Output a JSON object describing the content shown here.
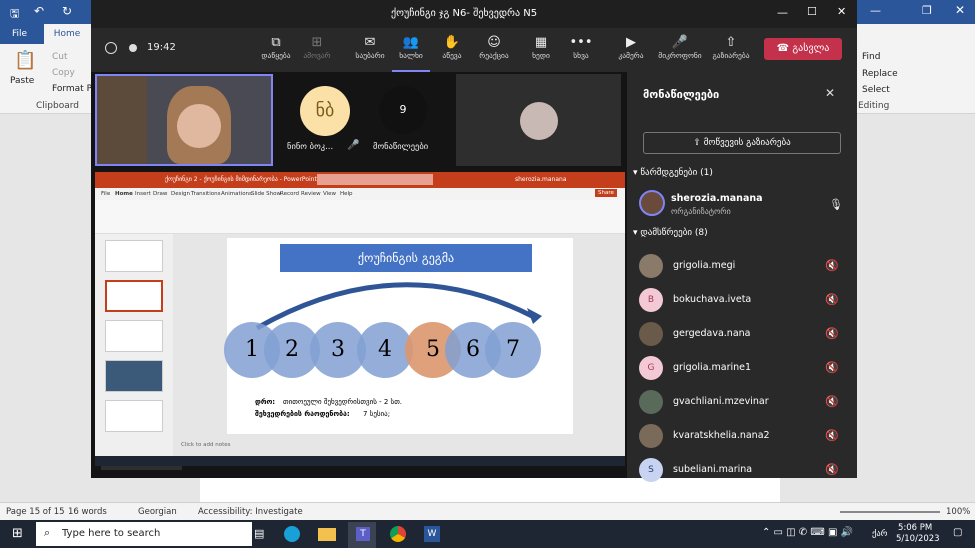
{
  "word": {
    "tabs": [
      "File",
      "Home"
    ],
    "clipboard": {
      "paste": "Paste",
      "cut": "Cut",
      "copy": "Copy",
      "format_painter": "Format Pai",
      "group": "Clipboard"
    },
    "editing": {
      "find": "Find",
      "replace": "Replace",
      "select": "Select",
      "group": "Editing"
    },
    "status": {
      "page": "Page 15 of 15",
      "words": "16 words",
      "language": "Georgian",
      "accessibility": "Accessibility: Investigate",
      "zoom": "100%"
    }
  },
  "teams": {
    "title": "ქოუჩინგი ჯგ N6- შეხვედრა N5",
    "timer": "19:42",
    "toolbar": [
      {
        "icon": "⧉",
        "label": "დაწყება"
      },
      {
        "icon": "⊞",
        "label": "ამოვარ"
      },
      {
        "icon": "✉",
        "label": "საუბარი"
      },
      {
        "icon": "👥",
        "label": "ხალხი"
      },
      {
        "icon": "✋",
        "label": "აწევა"
      },
      {
        "icon": "☺",
        "label": "რეაქცია"
      },
      {
        "icon": "▦",
        "label": "ხედი"
      },
      {
        "icon": "•••",
        "label": "სხვა"
      },
      {
        "icon": "▶",
        "label": "კამერა"
      },
      {
        "icon": "🎤",
        "label": "მიკროფონი"
      },
      {
        "icon": "⇧",
        "label": "გაზიარება"
      }
    ],
    "leave_label": "გასვლა",
    "tiles": {
      "avatar_initials": "ნბ",
      "avatar_name": "ნინო ბოკ...",
      "others_count": "9",
      "others_label": "მონაწილეები",
      "presenter_name": "sherozia.manana"
    },
    "panel": {
      "title": "მონაწილეები",
      "share_invite": "მოწვევის გაზიარება",
      "presenters_header": "წარმდგენები (1)",
      "organizer_name": "sherozia.manana",
      "organizer_role": "ორგანიზატორი",
      "attendees_header": "დამსწრეები (8)",
      "attendees": [
        {
          "name": "grigolia.megi",
          "initial": "",
          "color": "#8a7a6a"
        },
        {
          "name": "bokuchava.iveta",
          "initial": "B",
          "color": "#f4c9d6"
        },
        {
          "name": "gergedava.nana",
          "initial": "",
          "color": "#6a5a4a"
        },
        {
          "name": "grigolia.marine1",
          "initial": "G",
          "color": "#f4c9d6"
        },
        {
          "name": "gvachliani.mzevinar",
          "initial": "",
          "color": "#5a6a5a"
        },
        {
          "name": "kvaratskhelia.nana2",
          "initial": "",
          "color": "#7a6a5a"
        },
        {
          "name": "subeliani.marina",
          "initial": "S",
          "color": "#c7d3f0"
        }
      ]
    }
  },
  "slide": {
    "title": "ქოუჩინგის გეგმა",
    "steps": [
      "1",
      "2",
      "3",
      "4",
      "5",
      "6",
      "7"
    ],
    "time_label": "დრო:",
    "time_text": "თითოეული შეხვედრისთვის - 2 სთ.",
    "count_label": "შეხვედრების რაოდენობა:",
    "count_text": "7 სესია;",
    "notes_hint": "Click to add notes",
    "ppt_title": "ქოუჩინგი 2 - ქოუჩინგის მიმდინარეობა - PowerPoint",
    "ppt_user": "sherozia.manana",
    "ppt_tabs": [
      "File",
      "Home",
      "Insert",
      "Draw",
      "Design",
      "Transitions",
      "Animations",
      "Slide Show",
      "Record",
      "Review",
      "View",
      "Help"
    ],
    "share_btn": "Share"
  },
  "taskbar": {
    "search_placeholder": "Type here to search",
    "time": "5:06 PM",
    "date": "5/10/2023",
    "lang": "ქარ"
  }
}
